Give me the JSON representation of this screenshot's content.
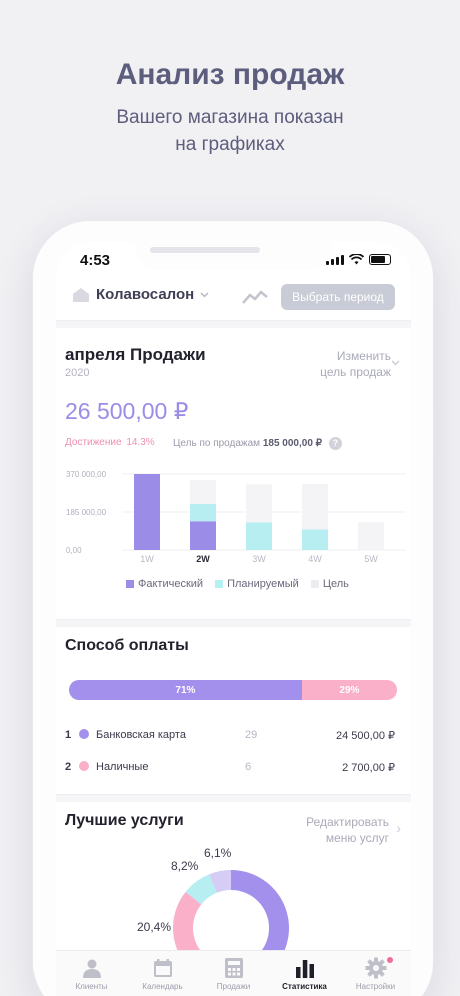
{
  "promo": {
    "title": "Анализ продаж",
    "subtitle_line1": "Вашего магазина показан",
    "subtitle_line2": "на графиках"
  },
  "status_bar": {
    "time": "4:53"
  },
  "header": {
    "store_name": "Колавосалон",
    "period_button": "Выбрать период"
  },
  "sales": {
    "title": "апреля Продажи",
    "year": "2020",
    "change_goal_line1": "Изменить",
    "change_goal_line2": "цель продаж",
    "amount": "26 500,00 ₽",
    "achievement_label": "Достижение",
    "achievement_value": "14.3%",
    "goal_label": "Цель по продажам",
    "goal_value": "185 000,00 ₽",
    "help": "?"
  },
  "chart_data": {
    "type": "bar",
    "categories": [
      "1W",
      "2W",
      "3W",
      "4W",
      "5W"
    ],
    "series": [
      {
        "name": "Фактический",
        "values": [
          370000,
          140000,
          0,
          0,
          0
        ],
        "color": "#9b8ce8"
      },
      {
        "name": "Планируемый",
        "values": [
          0,
          85000,
          135000,
          100000,
          0
        ],
        "color": "#b6eef2"
      },
      {
        "name": "Цель",
        "values": [
          0,
          115000,
          185000,
          222000,
          135000
        ],
        "color": "#f4f4f6"
      }
    ],
    "stacked": true,
    "ylim": [
      0,
      370000
    ],
    "yticks": [
      "370 000,00",
      "185 000,00",
      "0,00"
    ],
    "ytick_values": [
      370000,
      185000,
      0
    ],
    "active_category": "2W",
    "legend": "bottom"
  },
  "payment": {
    "title": "Способ оплаты",
    "bar": [
      {
        "label": "71%",
        "value": 71,
        "color": "#a390ec"
      },
      {
        "label": "29%",
        "value": 29,
        "color": "#f9b0c8"
      }
    ],
    "rows": [
      {
        "index": "1",
        "name": "Банковская карта",
        "count": "29",
        "amount": "24 500,00 ₽",
        "color": "#a390ec"
      },
      {
        "index": "2",
        "name": "Наличные",
        "count": "6",
        "amount": "2 700,00 ₽",
        "color": "#f9b0c8"
      }
    ]
  },
  "services": {
    "title": "Лучшие услуги",
    "edit_line1": "Редактировать",
    "edit_line2": "меню услуг",
    "donut": [
      {
        "label": "",
        "value": 65.3,
        "color": "#a390ec"
      },
      {
        "label": "20,4%",
        "value": 20.4,
        "color": "#f9b0c8"
      },
      {
        "label": "8,2%",
        "value": 8.2,
        "color": "#b6eef2"
      },
      {
        "label": "6,1%",
        "value": 6.1,
        "color": "#d6cdf6"
      }
    ]
  },
  "tabbar": {
    "items": [
      {
        "label": "Клиенты",
        "icon": "person-icon"
      },
      {
        "label": "Календарь",
        "icon": "calendar-icon"
      },
      {
        "label": "Продажи",
        "icon": "calculator-icon"
      },
      {
        "label": "Статистика",
        "icon": "bar-chart-icon",
        "active": true
      },
      {
        "label": "Настройки",
        "icon": "gear-icon"
      }
    ]
  }
}
